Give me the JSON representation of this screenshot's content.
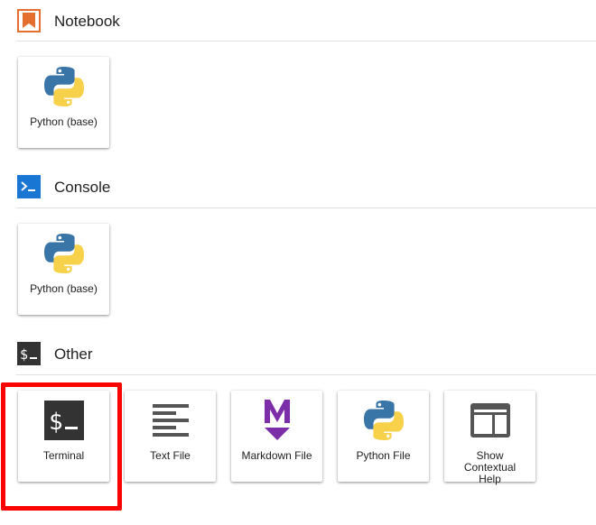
{
  "sections": {
    "notebook": {
      "title": "Notebook",
      "icon": "notebook-bookmark-icon",
      "accent": "#e46e2e",
      "items": [
        {
          "label": "Python (base)",
          "icon": "python-logo-icon"
        }
      ]
    },
    "console": {
      "title": "Console",
      "icon": "console-prompt-icon",
      "accent": "#1976d2",
      "items": [
        {
          "label": "Python (base)",
          "icon": "python-logo-icon"
        }
      ]
    },
    "other": {
      "title": "Other",
      "icon": "terminal-dollar-icon",
      "accent": "#333333",
      "items": [
        {
          "label": "Terminal",
          "icon": "terminal-dollar-icon"
        },
        {
          "label": "Text File",
          "icon": "text-lines-icon"
        },
        {
          "label": "Markdown File",
          "icon": "markdown-m-icon"
        },
        {
          "label": "Python File",
          "icon": "python-logo-icon"
        },
        {
          "label": "Show\nContextual\nHelp",
          "icon": "contextual-help-icon"
        }
      ]
    }
  },
  "colors": {
    "python_blue": "#3a75a8",
    "python_yellow": "#f7d14a",
    "markdown_purple": "#7b2ea8",
    "highlight": "#ff0000"
  }
}
